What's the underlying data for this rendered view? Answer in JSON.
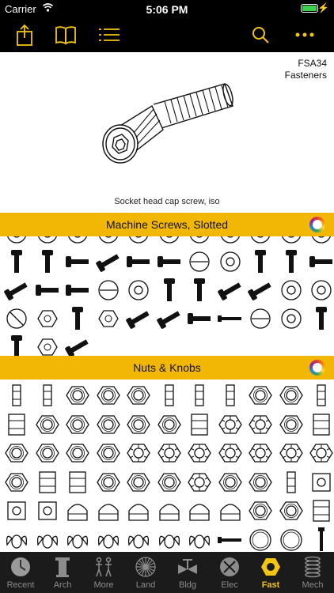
{
  "status": {
    "carrier": "Carrier",
    "time": "5:06 PM"
  },
  "toolbar": {
    "accent": "#f2c512",
    "left_icons": [
      "share-icon",
      "book-icon",
      "list-icon"
    ],
    "right_icons": [
      "search-icon",
      "more-icon"
    ]
  },
  "preview": {
    "code": "FSA34",
    "category": "Fasteners",
    "caption": "Socket head cap screw, iso"
  },
  "sections": [
    {
      "title": "Machine Screws, Slotted"
    },
    {
      "title": "Nuts & Knobs"
    }
  ],
  "tabs": [
    {
      "label": "Recent",
      "icon": "clock-icon",
      "active": false
    },
    {
      "label": "Arch",
      "icon": "column-icon",
      "active": false
    },
    {
      "label": "More",
      "icon": "figures-icon",
      "active": false
    },
    {
      "label": "Land",
      "icon": "tree-icon",
      "active": false
    },
    {
      "label": "Bldg",
      "icon": "valve-icon",
      "active": false
    },
    {
      "label": "Elec",
      "icon": "dish-icon",
      "active": false
    },
    {
      "label": "Fast",
      "icon": "nut-icon",
      "active": true
    },
    {
      "label": "Mech",
      "icon": "spring-icon",
      "active": false
    }
  ],
  "colors": {
    "header_bg": "#f2b705",
    "tab_active": "#f2c512",
    "tab_inactive": "#8c8c8c"
  }
}
